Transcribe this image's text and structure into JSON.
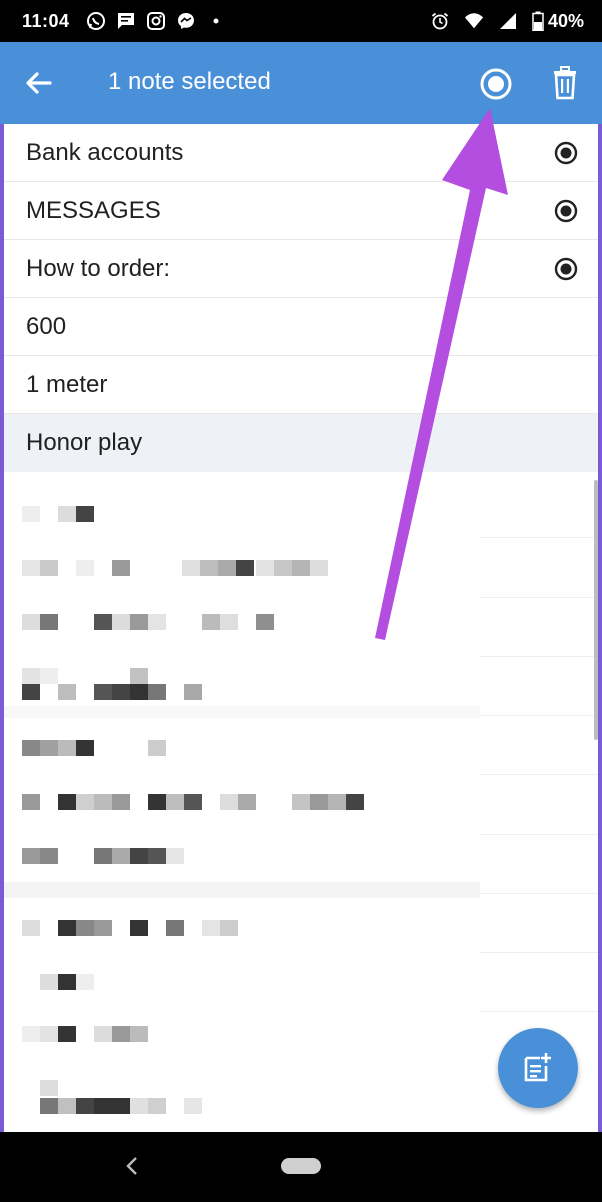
{
  "status_bar": {
    "time": "11:04",
    "battery": "40%",
    "left_icons": [
      "whatsapp-icon",
      "message-icon",
      "instagram-icon",
      "messenger-icon",
      "dot-icon"
    ],
    "right_icons": [
      "alarm-icon",
      "wifi-icon",
      "signal-icon",
      "battery-icon"
    ]
  },
  "app_bar": {
    "title": "1 note selected",
    "color": "#4a90d9"
  },
  "notes": [
    {
      "title": "Bank accounts",
      "selected": true
    },
    {
      "title": "MESSAGES",
      "selected": true
    },
    {
      "title": "How to order:",
      "selected": true
    },
    {
      "title": "600",
      "selected": false
    },
    {
      "title": "1 meter",
      "selected": false
    },
    {
      "title": "Honor play",
      "selected": false,
      "highlighted": true
    }
  ],
  "annotation": {
    "arrow_color": "#b34ee0"
  }
}
